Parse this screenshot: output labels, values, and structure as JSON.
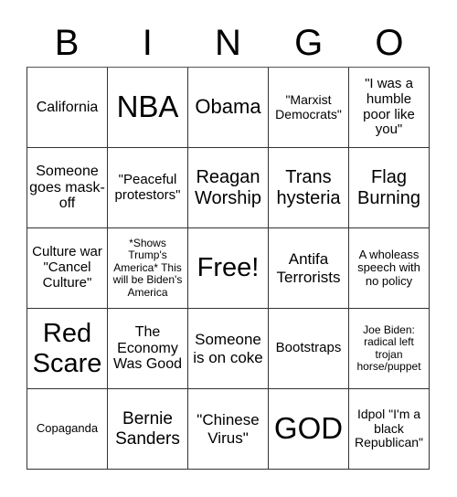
{
  "header": {
    "letters": [
      "B",
      "I",
      "N",
      "G",
      "O"
    ]
  },
  "cells": [
    [
      "California",
      "NBA",
      "Obama",
      "\"Marxist Democrats\"",
      "\"I was a humble poor like you\""
    ],
    [
      "Someone goes mask-off",
      "\"Peaceful protestors\"",
      "Reagan Worship",
      "Trans hysteria",
      "Flag Burning"
    ],
    [
      "Culture war \"Cancel Culture\"",
      "*Shows Trump's America* This will be Biden's America",
      "Free!",
      "Antifa Terrorists",
      "A wholeass speech with no policy"
    ],
    [
      "Red Scare",
      "The Economy Was Good",
      "Someone is on coke",
      "Bootstraps",
      "Joe Biden: radical left trojan horse/puppet"
    ],
    [
      "Copaganda",
      "Bernie Sanders",
      "\"Chinese Virus\"",
      "GOD",
      "Idpol \"I'm a black Republican\""
    ]
  ]
}
